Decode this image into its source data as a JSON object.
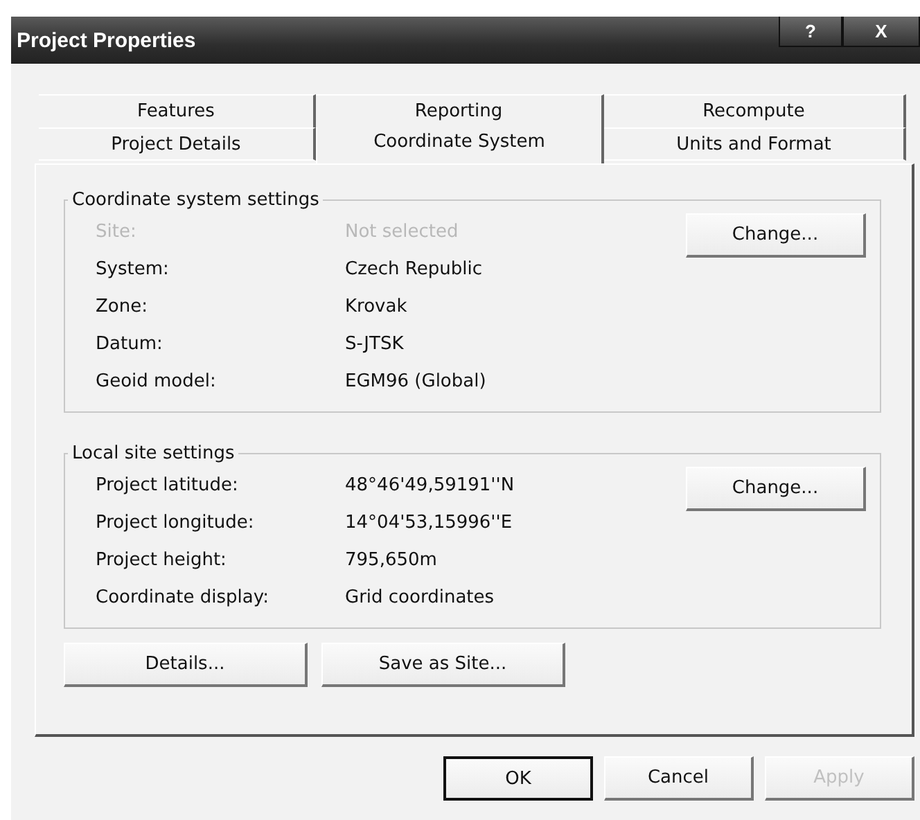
{
  "window": {
    "title": "Project Properties",
    "controls": [
      {
        "kind": "help",
        "label": "?"
      },
      {
        "kind": "close",
        "label": "X"
      }
    ]
  },
  "tab_rows": [
    [
      {
        "label": "Features",
        "selected": false
      },
      {
        "label": "Reporting",
        "selected": false
      },
      {
        "label": "Recompute",
        "selected": false
      }
    ],
    [
      {
        "label": "Project Details",
        "selected": false
      },
      {
        "label": "Coordinate System",
        "selected": true
      },
      {
        "label": "Units and Format",
        "selected": false
      }
    ]
  ],
  "groups": [
    {
      "title": "Coordinate system settings",
      "button": "Change...",
      "rows": [
        {
          "label": "Site:",
          "value": "Not selected",
          "disabled": true
        },
        {
          "label": "System:",
          "value": "Czech Republic",
          "disabled": false
        },
        {
          "label": "Zone:",
          "value": "Krovak",
          "disabled": false
        },
        {
          "label": "Datum:",
          "value": "S-JTSK",
          "disabled": false
        },
        {
          "label": "Geoid model:",
          "value": "EGM96 (Global)",
          "disabled": false
        }
      ]
    },
    {
      "title": "Local site settings",
      "button": "Change...",
      "rows": [
        {
          "label": "Project latitude:",
          "value": "48°46'49,59191''N",
          "disabled": false
        },
        {
          "label": "Project longitude:",
          "value": "14°04'53,15996''E",
          "disabled": false
        },
        {
          "label": "Project height:",
          "value": "795,650m",
          "disabled": false
        },
        {
          "label": "Coordinate display:",
          "value": "Grid coordinates",
          "disabled": false
        }
      ]
    }
  ],
  "panel_buttons": [
    "Details...",
    "Save as Site..."
  ],
  "dialog_buttons": [
    {
      "label": "OK",
      "default": true,
      "disabled": false
    },
    {
      "label": "Cancel",
      "default": false,
      "disabled": false
    },
    {
      "label": "Apply",
      "default": false,
      "disabled": true
    }
  ]
}
